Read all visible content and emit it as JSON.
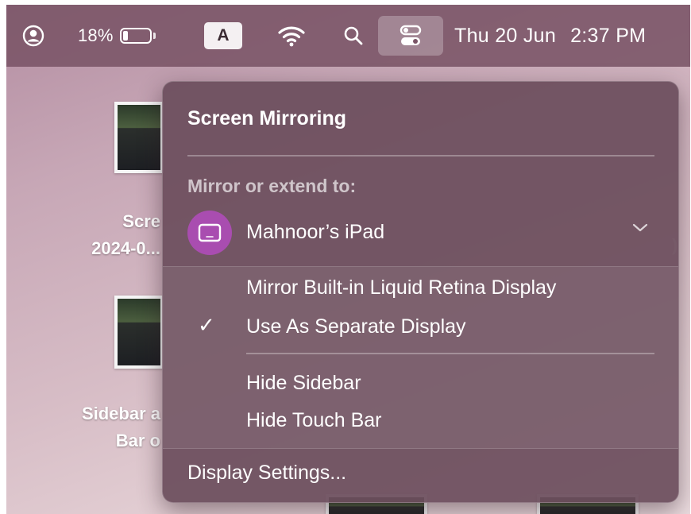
{
  "menubar": {
    "user_icon": "person-circle-icon",
    "battery_percent_label": "18%",
    "battery_level": 0.18,
    "input_source": "A",
    "wifi_icon": "wifi-icon",
    "search_icon": "magnifier-icon",
    "control_center_icon": "control-center-icon",
    "date": "Thu 20 Jun",
    "time": "2:37 PM"
  },
  "desktop": {
    "icon1_label_line1": "Scre",
    "icon1_label_line2": "2024-0...",
    "icon2_label_line1": "Sidebar a",
    "icon2_label_line2": "Bar o",
    "right_paren": ")"
  },
  "screen_mirroring": {
    "title": "Screen Mirroring",
    "section_label": "Mirror or extend to:",
    "device": {
      "name": "Mahnoor’s iPad",
      "icon": "ipad-display-icon",
      "expanded": true
    },
    "options": [
      {
        "label": "Mirror Built-in Liquid Retina Display",
        "checked": false
      },
      {
        "label": "Use As Separate Display",
        "checked": true
      }
    ],
    "extras": [
      {
        "label": "Hide Sidebar"
      },
      {
        "label": "Hide Touch Bar"
      }
    ],
    "settings_label": "Display Settings..."
  },
  "colors": {
    "menubar_bg": "#7a5466",
    "panel_bg": "#6c4e5c",
    "device_accent": "#a94db0"
  }
}
